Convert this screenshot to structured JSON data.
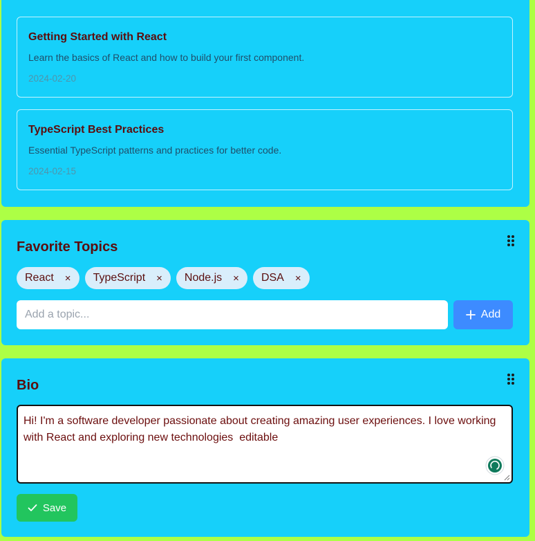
{
  "posts": [
    {
      "title": "Getting Started with React",
      "description": "Learn the basics of React and how to build your first component.",
      "date": "2024-02-20"
    },
    {
      "title": "TypeScript Best Practices",
      "description": "Essential TypeScript patterns and practices for better code.",
      "date": "2024-02-15"
    }
  ],
  "topics": {
    "title": "Favorite Topics",
    "tags": [
      "React",
      "TypeScript",
      "Node.js",
      "DSA"
    ],
    "remove_glyph": "×",
    "input_placeholder": "Add a topic...",
    "add_label": "Add",
    "add_icon": "plus-icon"
  },
  "bio": {
    "title": "Bio",
    "text": "Hi! I'm a software developer passionate about creating amazing user experiences. I love working with React and exploring new technologies  editable",
    "save_label": "Save",
    "save_icon": "check-icon"
  },
  "colors": {
    "page_background": "#adff45",
    "card_background": "#16d0fa",
    "heading_text": "#5b0d0d",
    "tag_background": "#d9eefb",
    "add_button": "#3d8bff",
    "save_button": "#22c55e"
  }
}
